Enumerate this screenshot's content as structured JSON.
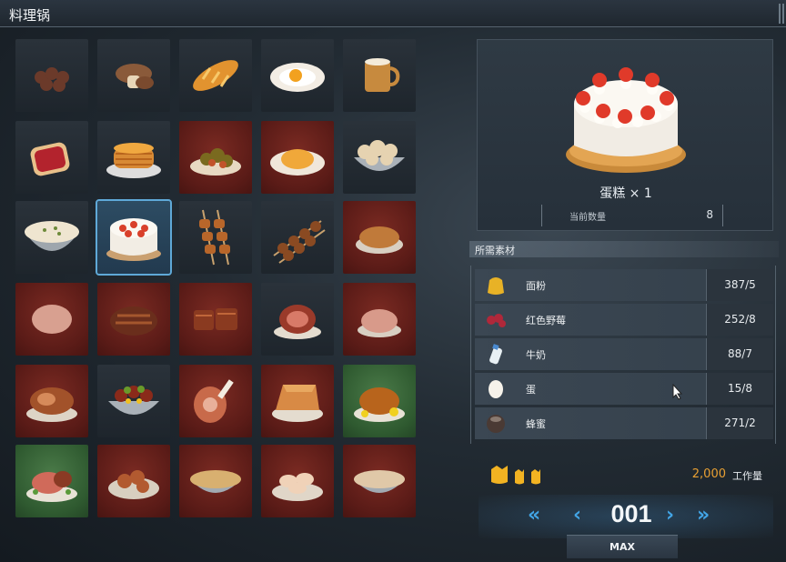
{
  "window": {
    "title": "料理锅"
  },
  "grid": {
    "rows": [
      [
        "dark",
        "dark",
        "dark",
        "dark",
        "dark"
      ],
      [
        "dark",
        "dark",
        "red",
        "red",
        "dark"
      ],
      [
        "dark",
        "selected",
        "dark",
        "dark",
        "red"
      ],
      [
        "red",
        "red",
        "red",
        "dark",
        "red"
      ],
      [
        "red",
        "dark",
        "red",
        "red",
        "green"
      ],
      [
        "green",
        "red",
        "red",
        "red",
        "red"
      ]
    ],
    "items": [
      "berries-icon",
      "mushroom-icon",
      "bread-icon",
      "fried-egg-icon",
      "milk-mug-icon",
      "jam-toast-icon",
      "pancakes-icon",
      "salad-icon",
      "omelette-icon",
      "mushroom-bowl-icon",
      "cream-soup-icon",
      "cake-icon",
      "skewers-icon",
      "meat-skewers-icon",
      "roast-meat-icon",
      "meat-chunk-icon",
      "roast-loaf-icon",
      "sliced-meat-icon",
      "ham-plate-icon",
      "meat-cut-icon",
      "roast-plate-icon",
      "veggie-bowl-icon",
      "drumstick-icon",
      "pie-icon",
      "roast-chicken-icon",
      "steak-plate-icon",
      "fried-dish-icon",
      "noodle-bowl-icon",
      "dumpling-plate-icon",
      "stew-bowl-icon"
    ],
    "selected_index": 11
  },
  "detail": {
    "item_name": "蛋糕 × 1",
    "current_label": "当前数量",
    "current_value": "8"
  },
  "materials": {
    "header": "所需素材",
    "rows": [
      {
        "name": "面粉",
        "qty": "387/5",
        "icon": "flour-bag-icon"
      },
      {
        "name": "红色野莓",
        "qty": "252/8",
        "icon": "red-berries-icon"
      },
      {
        "name": "牛奶",
        "qty": "88/7",
        "icon": "milk-bottle-icon"
      },
      {
        "name": "蛋",
        "qty": "15/8",
        "icon": "egg-icon"
      },
      {
        "name": "蜂蜜",
        "qty": "271/2",
        "icon": "honey-jar-icon"
      }
    ]
  },
  "workload": {
    "amount": "2,000",
    "unit": "工作量"
  },
  "quantity": {
    "value": "001",
    "dec_fast": "«",
    "dec": "‹",
    "inc": "›",
    "inc_fast": "»",
    "max_label": "MAX"
  }
}
